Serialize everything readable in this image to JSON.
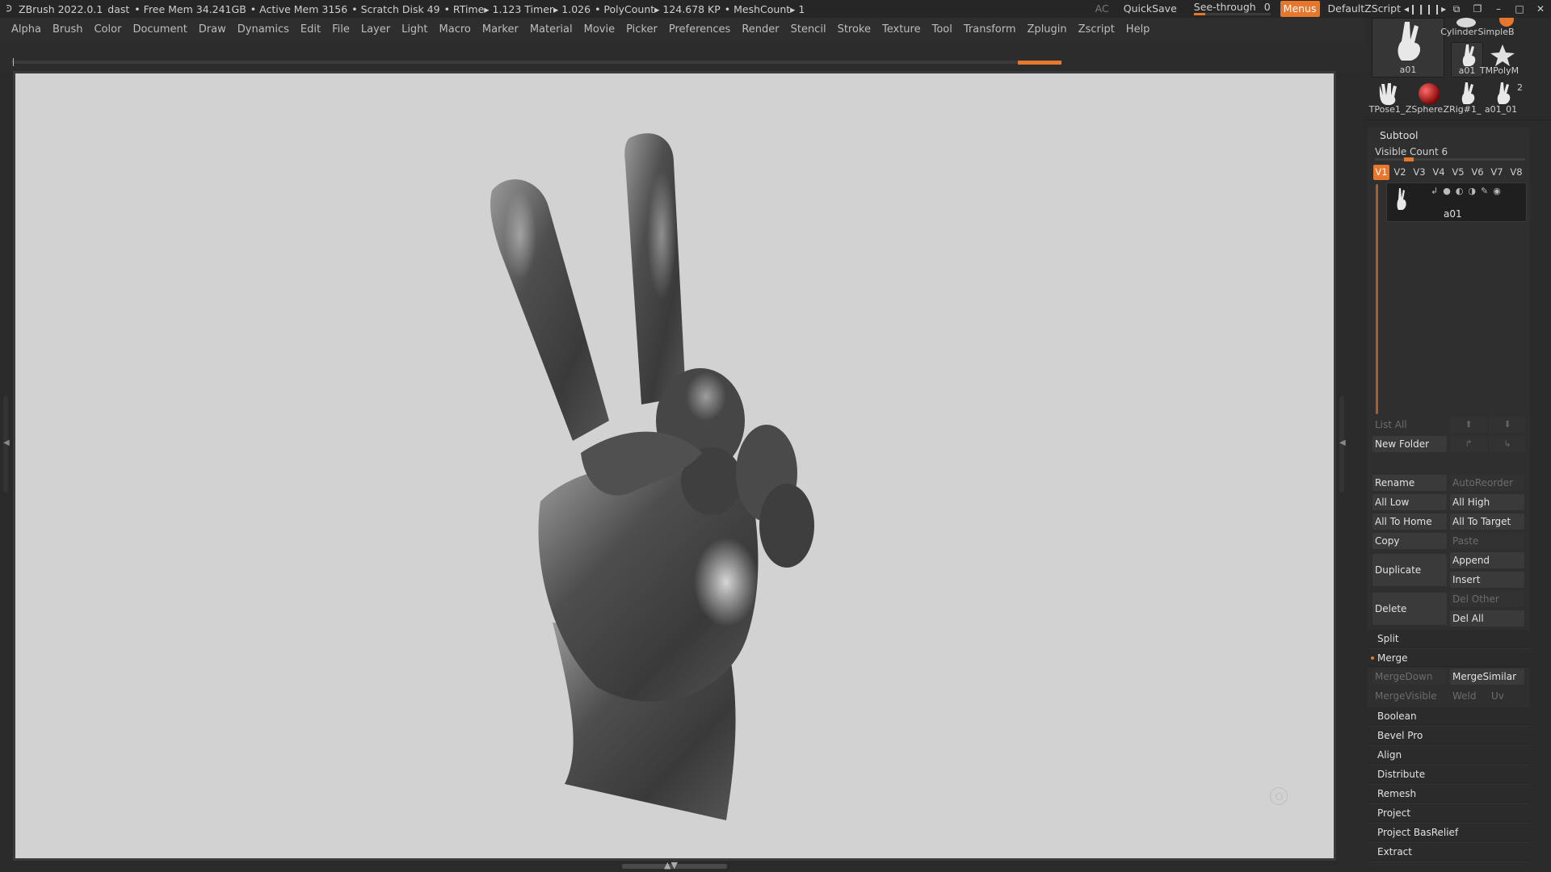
{
  "titlebar": {
    "app": "ZBrush 2022.0.1",
    "doc": "dast",
    "free_mem": "• Free Mem 34.241GB",
    "active_mem": "• Active Mem 3156",
    "scratch": "• Scratch Disk 49",
    "rtime": "• RTime▸ 1.123 Timer▸ 1.026",
    "polycount": "• PolyCount▸ 124.678 KP",
    "meshcount": "• MeshCount▸ 1",
    "ac": "AC",
    "quicksave": "QuickSave",
    "see_through_label": "See-through",
    "see_through_value": "0",
    "menus": "Menus",
    "default_zscript": "DefaultZScript"
  },
  "menubar": [
    "Alpha",
    "Brush",
    "Color",
    "Document",
    "Draw",
    "Dynamics",
    "Edit",
    "File",
    "Layer",
    "Light",
    "Macro",
    "Marker",
    "Material",
    "Movie",
    "Picker",
    "Preferences",
    "Render",
    "Stencil",
    "Stroke",
    "Texture",
    "Tool",
    "Transform",
    "Zplugin",
    "Zscript",
    "Help"
  ],
  "tools": {
    "current": "a01",
    "cylinder": "Cylinder",
    "simple": "SimpleB",
    "small_a01": "a01",
    "tmpoly": "TMPolyM",
    "tpose": "TPose1_",
    "zsphere": "ZSphere",
    "zrig": "ZRig#1_",
    "a01_01": "a01_01",
    "a01_01_count": "2"
  },
  "subtool": {
    "title": "Subtool",
    "visible_count_label": "Visible Count",
    "visible_count": "6",
    "versions": [
      "V1",
      "V2",
      "V3",
      "V4",
      "V5",
      "V6",
      "V7",
      "V8"
    ],
    "item_name": "a01",
    "list_all": "List All",
    "new_folder": "New Folder",
    "rename": "Rename",
    "autoreorder": "AutoReorder",
    "all_low": "All Low",
    "all_high": "All High",
    "all_to_home": "All To Home",
    "all_to_target": "All To Target",
    "copy": "Copy",
    "paste": "Paste",
    "duplicate": "Duplicate",
    "append": "Append",
    "insert": "Insert",
    "delete": "Delete",
    "del_other": "Del Other",
    "del_all": "Del All",
    "split": "Split",
    "merge": "Merge",
    "mergedown": "MergeDown",
    "mergesimilar": "MergeSimilar",
    "mergevisible": "MergeVisible",
    "weld": "Weld",
    "uv": "Uv",
    "boolean": "Boolean",
    "bevel_pro": "Bevel Pro",
    "align": "Align",
    "distribute": "Distribute",
    "remesh": "Remesh",
    "project": "Project",
    "project_basrelief": "Project BasRelief",
    "extract": "Extract"
  },
  "colors": {
    "accent": "#e8772e",
    "canvas": "#d2d2d2",
    "panel": "#2b2b2b"
  },
  "icons": [
    "zbrush-logo-icon",
    "gizmo-icon",
    "hand-model-icon",
    "sphere-icon",
    "star-icon"
  ]
}
